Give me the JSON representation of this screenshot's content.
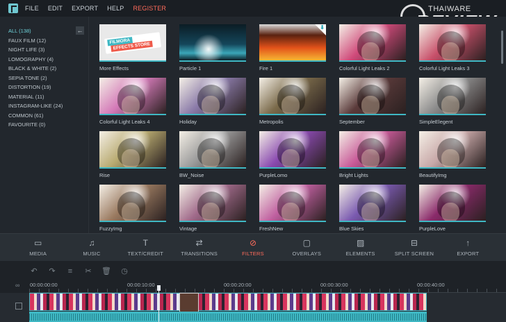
{
  "menu": [
    "FILE",
    "EDIT",
    "EXPORT",
    "HELP"
  ],
  "register": "REGISTER",
  "watermark": {
    "top": "THAIWARE",
    "bottom": "REVIEW"
  },
  "sidebar": {
    "collapse_icon": "arrow-left-icon",
    "categories": [
      "ALL (138)",
      "FAUX FILM (12)",
      "NIGHT LIFE (3)",
      "LOMOGRAPHY (4)",
      "BLACK & WHITE (2)",
      "SEPIA TONE (2)",
      "DISTORTION (19)",
      "MATERIAL (11)",
      "INSTAGRAM-LIKE (24)",
      "COMMON (61)",
      "FAVOURITE (0)"
    ]
  },
  "store_card": {
    "line1": "FILMORA",
    "line2": "EFFECTS STORE"
  },
  "filters": [
    {
      "label": "More Effects",
      "tint": "#e8e8e8"
    },
    {
      "label": "Particle 1",
      "tint": "#1d7a86"
    },
    {
      "label": "Fire 1",
      "tint": "#e2701a"
    },
    {
      "label": "Colorful Light Leaks 2",
      "tint": "#d04a7a"
    },
    {
      "label": "Colorful Light Leaks 3",
      "tint": "#c8506a"
    },
    {
      "label": "Colorful Light Leaks 4",
      "tint": "#d47ab8"
    },
    {
      "label": "Holiday",
      "tint": "#8a7aa8"
    },
    {
      "label": "Metropolis",
      "tint": "#7a6a4a"
    },
    {
      "label": "September",
      "tint": "#5a3a3a"
    },
    {
      "label": "SimpleElegent",
      "tint": "#8c8c8c"
    },
    {
      "label": "Rise",
      "tint": "#b8aa70"
    },
    {
      "label": "BW_Noise",
      "tint": "#9a9a9a"
    },
    {
      "label": "PurpleLomo",
      "tint": "#8a4ab0"
    },
    {
      "label": "Bright Lights",
      "tint": "#c85a98"
    },
    {
      "label": "BeautifyImg",
      "tint": "#c8a8a8"
    },
    {
      "label": "FuzzyImg",
      "tint": "#9a7a60"
    },
    {
      "label": "Vintage",
      "tint": "#a06a8a"
    },
    {
      "label": "FreshNew",
      "tint": "#c060a0"
    },
    {
      "label": "Blue Skies",
      "tint": "#7a5ab0"
    },
    {
      "label": "PurpleLove",
      "tint": "#8a2a6a"
    }
  ],
  "toolbar": [
    {
      "label": "MEDIA",
      "icon": "folder-icon",
      "active": false
    },
    {
      "label": "MUSIC",
      "icon": "music-note-icon",
      "active": false
    },
    {
      "label": "TEXT/CREDIT",
      "icon": "text-icon",
      "active": false
    },
    {
      "label": "TRANSITIONS",
      "icon": "transitions-icon",
      "active": false
    },
    {
      "label": "FILTERS",
      "icon": "filters-icon",
      "active": true
    },
    {
      "label": "OVERLAYS",
      "icon": "overlays-icon",
      "active": false
    },
    {
      "label": "ELEMENTS",
      "icon": "image-icon",
      "active": false
    },
    {
      "label": "SPLIT SCREEN",
      "icon": "split-screen-icon",
      "active": false
    },
    {
      "label": "EXPORT",
      "icon": "export-icon",
      "active": false
    }
  ],
  "timeline": {
    "timecodes": [
      "00:00:00:00",
      "00:00:10:00",
      "00:00:20:00",
      "00:00:30:00",
      "00:00:40:00"
    ]
  },
  "colors": {
    "accent": "#3fb8c4",
    "active": "#ff6b5b",
    "background": "#22272d"
  }
}
